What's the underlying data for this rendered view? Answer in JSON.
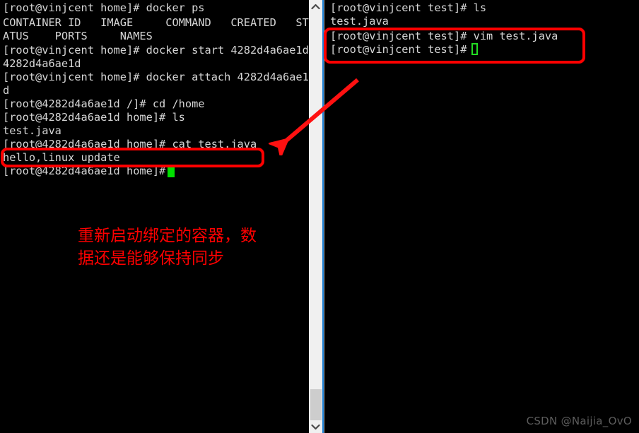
{
  "left_terminal": {
    "name": "left-terminal-pane",
    "background": "#000000",
    "foreground": "#d6d6d6",
    "lines": [
      "[root@vinjcent home]# docker ps",
      "CONTAINER ID   IMAGE     COMMAND   CREATED   ST",
      "ATUS    PORTS     NAMES",
      "[root@vinjcent home]# docker start 4282d4a6ae1d",
      "4282d4a6ae1d",
      "[root@vinjcent home]# docker attach 4282d4a6ae1",
      "d",
      "[root@4282d4a6ae1d /]# cd /home",
      "[root@4282d4a6ae1d home]# ls",
      "test.java",
      "[root@4282d4a6ae1d home]# cat test.java",
      "hello,linux update",
      "[root@4282d4a6ae1d home]# "
    ],
    "cursor": {
      "name": "left-cursor",
      "style": "solid-block",
      "color": "#00e000"
    }
  },
  "right_terminal": {
    "name": "right-terminal-pane",
    "background": "#000000",
    "foreground": "#d6d6d6",
    "lines": [
      "[root@vinjcent test]# ls",
      "test.java",
      "[root@vinjcent test]# vim test.java",
      "[root@vinjcent test]# "
    ],
    "cursor": {
      "name": "right-cursor",
      "style": "hollow-block",
      "color": "#22dd22"
    }
  },
  "scrollbar": {
    "name": "vertical-scrollbar",
    "track_color": "#f0f0f0",
    "thumb_color": "#cdcdcd",
    "accent_line_color": "#1a7fd4",
    "up_arrow": "▲",
    "down_arrow": "▼"
  },
  "annotations": {
    "accent_color": "#ff0000",
    "left_highlight_label": "hello,linux update",
    "right_highlight_label": "vim test.java prompt block",
    "arrow_label": "arrow-pointing-to-output",
    "note_line1": "重新启动绑定的容器，数",
    "note_line2": "据还是能够保持同步"
  },
  "watermark": {
    "text": "CSDN @Naijia_OvO",
    "color": "#5d5d5d"
  }
}
